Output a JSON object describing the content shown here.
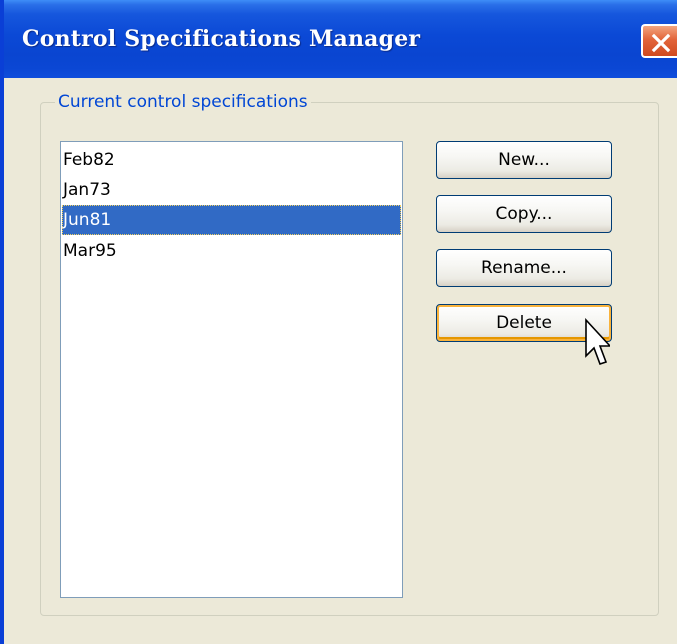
{
  "window": {
    "title": "Control Specifications Manager"
  },
  "group": {
    "label": "Current control specifications"
  },
  "list": {
    "items": [
      "Feb82",
      "Jan73",
      "Jun81",
      "Mar95"
    ],
    "selected": "Jun81"
  },
  "buttons": {
    "new_label": "New...",
    "copy_label": "Copy...",
    "rename_label": "Rename...",
    "delete_label": "Delete"
  },
  "colors": {
    "titlebar": "#0a45d1",
    "selection": "#316ac5",
    "group_label": "#0046d5",
    "close_button": "#e2643a",
    "hot_button_border": "#f9b33c"
  },
  "icons": {
    "close": "close-icon",
    "cursor": "mouse-pointer-icon"
  }
}
